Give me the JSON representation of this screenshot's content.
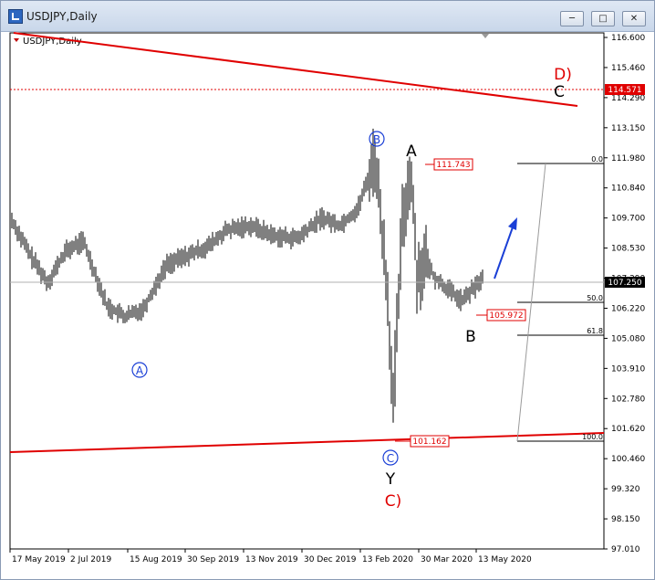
{
  "window": {
    "title": "USDJPY,Daily",
    "minimize_icon": "minimize-icon",
    "maximize_icon": "maximize-icon",
    "close_icon": "close-icon"
  },
  "chart_label": "USDJPY,Daily",
  "chart_data": {
    "type": "bar",
    "symbol": "USDJPY",
    "timeframe": "Daily",
    "y_axis_ticks": [
      "116.600",
      "115.460",
      "114.290",
      "113.150",
      "111.980",
      "110.840",
      "109.700",
      "108.530",
      "107.390",
      "106.220",
      "105.080",
      "103.910",
      "102.780",
      "101.620",
      "100.460",
      "99.320",
      "98.150",
      "97.010"
    ],
    "ylim": [
      97.01,
      116.6
    ],
    "x_axis_ticks": [
      "17 May 2019",
      "2 Jul 2019",
      "15 Aug 2019",
      "30 Sep 2019",
      "13 Nov 2019",
      "30 Dec 2019",
      "13 Feb 2020",
      "30 Mar 2020",
      "13 May 2020"
    ],
    "price_path_x": [
      0,
      0.03,
      0.06,
      0.09,
      0.12,
      0.16,
      0.19,
      0.22,
      0.26,
      0.29,
      0.33,
      0.36,
      0.4,
      0.44,
      0.48,
      0.52,
      0.55,
      0.58,
      0.61,
      0.63,
      0.64,
      0.655,
      0.67,
      0.68,
      0.695,
      0.71,
      0.73,
      0.755,
      0.78,
      0.79
    ],
    "price_path_y": [
      109.6,
      108.3,
      107.2,
      108.4,
      108.8,
      106.3,
      105.9,
      106.2,
      107.9,
      108.2,
      108.6,
      109.2,
      109.4,
      109.0,
      108.9,
      109.7,
      109.4,
      110.0,
      112.0,
      107.0,
      102.4,
      109.5,
      111.5,
      107.5,
      108.0,
      107.4,
      107.0,
      106.5,
      107.1,
      107.4
    ],
    "current_price": "107.250",
    "price_labels": [
      {
        "text": "111.743",
        "value": 111.743
      },
      {
        "text": "105.972",
        "value": 105.972
      },
      {
        "text": "101.162",
        "value": 101.162
      },
      {
        "text": "114.571",
        "value": 114.571
      }
    ],
    "fibonacci_levels": [
      "0.0",
      "50.0",
      "61.8",
      "100.0"
    ],
    "wave_labels": {
      "circled_a": "A",
      "circled_b": "B",
      "circled_c": "C",
      "a": "A",
      "b": "B",
      "y": "Y",
      "c": "C",
      "c_paren": "C)",
      "d_paren": "D)"
    },
    "colors": {
      "trendline": "#e00000",
      "wave_circle": "#1a3fd6",
      "arrow": "#1a3fd6",
      "bars": "#000000",
      "grid": "#b0b0b0"
    }
  }
}
